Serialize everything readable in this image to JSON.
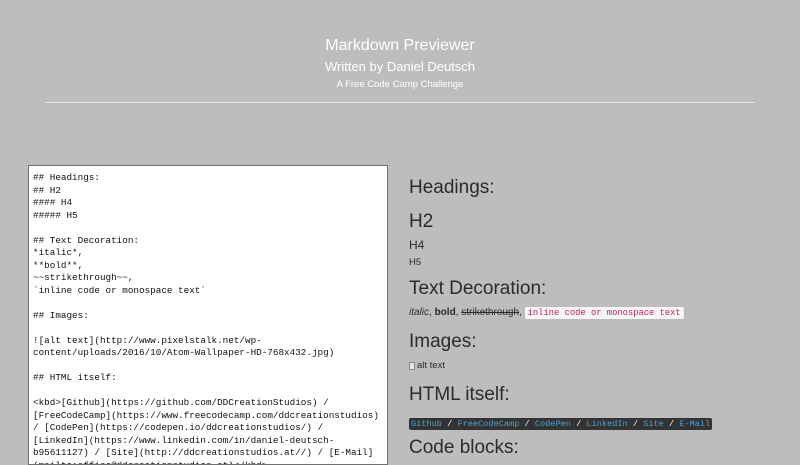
{
  "header": {
    "title": "Markdown Previewer",
    "subtitle": "Written by Daniel Deutsch",
    "tagline": "A Free Code Camp Challenge"
  },
  "editor": {
    "content": "## Headings:\n## H2\n#### H4\n##### H5\n\n## Text Decoration:\n*italic*,\n**bold**,\n~~strikethrough~~,\n`inline code or monospace text`\n\n## Images:\n\n![alt text](http://www.pixelstalk.net/wp-content/uploads/2016/10/Atom-Wallpaper-HD-768x432.jpg)\n\n## HTML itself:\n\n<kbd>[Github](https://github.com/DDCreationStudios) / [FreeCodeCamp](https://www.freecodecamp.com/ddcreationstudios) / [CodePen](https://codepen.io/ddcreationstudios/) / [LinkedIn](https://www.linkedin.com/in/daniel-deutsch-b95611127) / [Site](http://ddcreationstudios.at//) / [E-Mail](mailto:office@ddcreationstudios.at)</kbd>"
  },
  "preview": {
    "headings_title": "Headings:",
    "h2": "H2",
    "h4": "H4",
    "h5": "H5",
    "text_decoration_title": "Text Decoration:",
    "italic": "italic",
    "bold": "bold",
    "strike": "strikethrough",
    "inline_code": "inline code or monospace text",
    "sep": ", ",
    "images_title": "Images:",
    "alt_text": "alt text",
    "html_title": "HTML itself:",
    "links": [
      "Github",
      "FreeCodeCamp",
      "CodePen",
      "LinkedIn",
      "Site",
      "E-Mail"
    ],
    "link_sep": " / ",
    "code_blocks_title": "Code blocks:"
  },
  "colors": {
    "background": "#bdbdbd",
    "header_text": "#ffffff",
    "inline_code_text": "#c7254e",
    "kbd_background": "#333333",
    "kbd_link": "#4ba0d6"
  }
}
